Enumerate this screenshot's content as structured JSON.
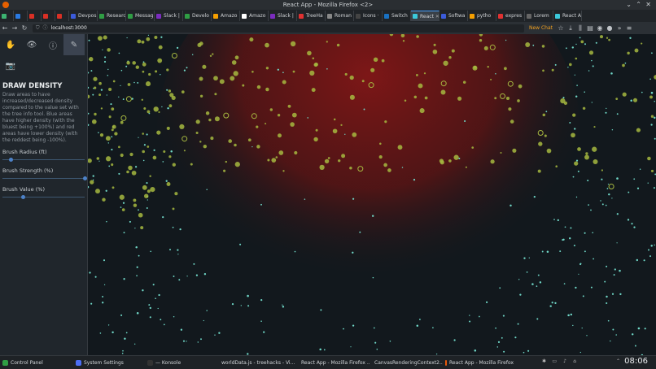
{
  "window": {
    "title": "React App - Mozilla Firefox <2>"
  },
  "tabs": [
    {
      "label": "",
      "color": "#3cb371"
    },
    {
      "label": "",
      "color": "#2a7ae2"
    },
    {
      "label": "",
      "color": "#d93025"
    },
    {
      "label": "",
      "color": "#d93025"
    },
    {
      "label": "",
      "color": "#d93025"
    },
    {
      "label": "Devpos",
      "color": "#3b5bdb"
    },
    {
      "label": "Researc",
      "color": "#2f9e44"
    },
    {
      "label": "Messag",
      "color": "#2f9e44"
    },
    {
      "label": "Slack |",
      "color": "#7b2cbf"
    },
    {
      "label": "Develo",
      "color": "#2f9e44"
    },
    {
      "label": "Amazo",
      "color": "#f59f00"
    },
    {
      "label": "Amazo",
      "color": "#ffffff"
    },
    {
      "label": "Slack |",
      "color": "#7b2cbf"
    },
    {
      "label": "TreeHa",
      "color": "#e03131"
    },
    {
      "label": "Roman",
      "color": "#888888"
    },
    {
      "label": "Icons ·",
      "color": "#444444"
    },
    {
      "label": "Switch",
      "color": "#1971c2"
    },
    {
      "label": "React",
      "color": "#3bc9db",
      "active": true
    },
    {
      "label": "Softwa",
      "color": "#3b5bdb"
    },
    {
      "label": "pytho",
      "color": "#f59f00"
    },
    {
      "label": "expres",
      "color": "#e03131"
    },
    {
      "label": "Lorem",
      "color": "#666666"
    },
    {
      "label": "React A",
      "color": "#3bc9db"
    }
  ],
  "nav": {
    "url": "localhost:3000",
    "new_chat": "New Chat"
  },
  "sidebar": {
    "title": "DRAW DENSITY",
    "description": "Draw areas to have increased/decreased density compared to the value set with the tree info tool. Blue areas have higher density (with the bluest being +100%) and red areas have lower density (with the reddest being -100%).",
    "sliders": [
      {
        "label": "Brush Radius (ft)",
        "value": 0.1
      },
      {
        "label": "Brush Strength (%)",
        "value": 1.0
      },
      {
        "label": "Brush Value (%)",
        "value": 0.25
      }
    ],
    "tools": [
      "hand-icon",
      "eye-icon",
      "info-icon",
      "brush-icon",
      "camera-icon"
    ]
  },
  "taskbar": {
    "items": [
      {
        "label": "Control Panel",
        "color": "#2f9e44"
      },
      {
        "label": "System Settings",
        "color": "#4c6ef5"
      },
      {
        "label": "— Konsole",
        "color": "#333333"
      },
      {
        "label": "worldData.js - treehacks - Vi...",
        "color": "#1c7ed6"
      },
      {
        "label": "React App - Mozilla Firefox ...",
        "color": "#e8590c"
      },
      {
        "label": "CanvasRenderingContext2...",
        "color": "#e8590c"
      },
      {
        "label": "React App - Mozilla Firefox",
        "color": "#e8590c"
      }
    ],
    "clock": "08:06"
  },
  "colors": {
    "tree_large": "#a6b840",
    "tree_small": "#6fd6c6",
    "low_density": "#7a1515"
  }
}
